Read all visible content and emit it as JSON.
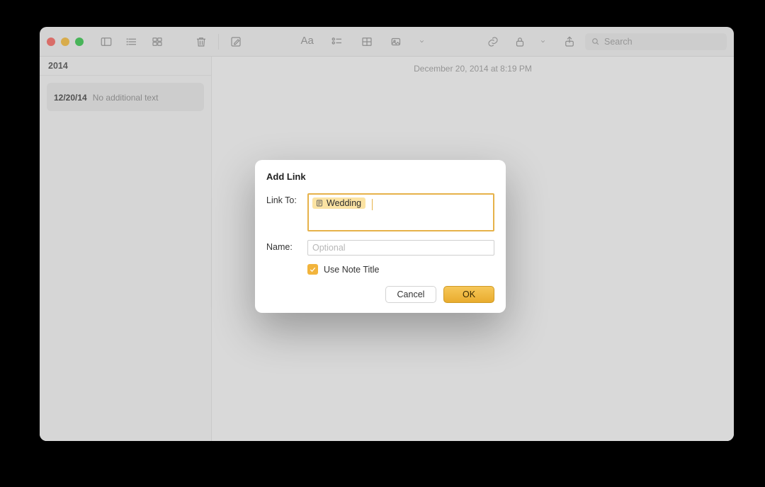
{
  "toolbar": {
    "search_placeholder": "Search"
  },
  "sidebar": {
    "section": "2014",
    "items": [
      {
        "title_glyph": "",
        "date": "12/20/14",
        "preview": "No additional text"
      }
    ]
  },
  "editor": {
    "timestamp": "December 20, 2014 at 8:19 PM",
    "body_glyph": ""
  },
  "modal": {
    "title": "Add Link",
    "link_to_label": "Link To:",
    "link_token": "Wedding",
    "name_label": "Name:",
    "name_placeholder": "Optional",
    "use_note_title": "Use Note Title",
    "cancel": "Cancel",
    "ok": "OK"
  }
}
